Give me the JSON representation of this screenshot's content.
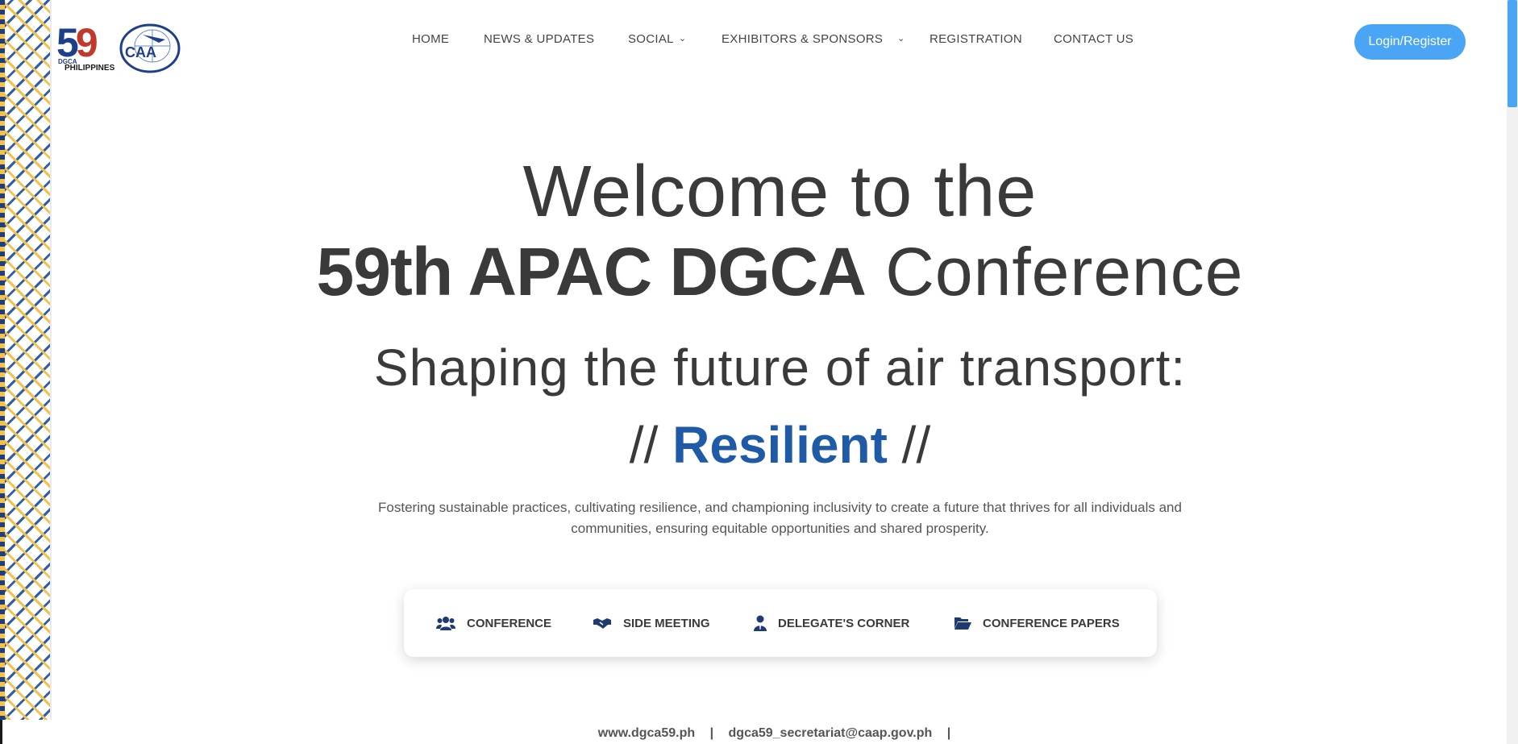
{
  "logos": {
    "event_logo": {
      "number": "59",
      "text_top": "DGCA",
      "text_bottom": "PHILIPPINES"
    },
    "caa_logo": {
      "text": "CAA"
    }
  },
  "nav": {
    "items": [
      "HOME",
      "NEWS & UPDATES",
      "SOCIAL",
      "EXHIBITORS & SPONSORS",
      "REGISTRATION",
      "CONTACT US"
    ],
    "login_label": "Login/Register"
  },
  "hero": {
    "line1": "Welcome to the",
    "line2_bold": "59th APAC DGCA",
    "line2_rest": "Conference",
    "subtitle": "Shaping the future of air transport:",
    "tagline_left": "//",
    "tagline_word": "Resilient",
    "tagline_right": "//",
    "description": "Fostering sustainable practices, cultivating resilience, and championing inclusivity to create a future that thrives for all individuals and communities, ensuring equitable opportunities and shared prosperity."
  },
  "tabs": [
    {
      "label": "CONFERENCE",
      "icon": "users-icon"
    },
    {
      "label": "SIDE MEETING",
      "icon": "handshake-icon"
    },
    {
      "label": "DELEGATE'S CORNER",
      "icon": "person-icon"
    },
    {
      "label": "CONFERENCE PAPERS",
      "icon": "folder-open-icon"
    }
  ],
  "footer": {
    "website": "www.dgca59.ph",
    "email": "dgca59_secretariat@caap.gov.ph",
    "separator": "|"
  },
  "colors": {
    "accent": "#4aa6f5",
    "brand_blue": "#1f5aa6",
    "text": "#3a3a3a",
    "weave_yellow": "#f2c14e",
    "weave_blue": "#2f5fa8"
  }
}
